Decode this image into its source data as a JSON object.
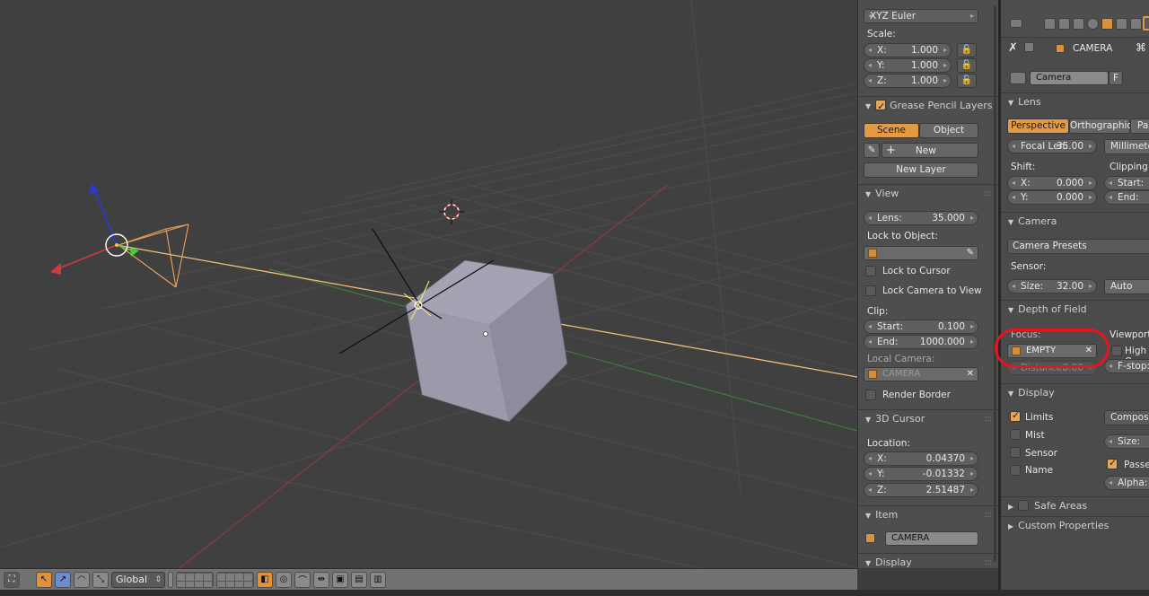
{
  "viewport": {
    "header": {
      "orientation": "Global",
      "colors": {
        "accent": "#e0913a",
        "annotation_red": "#e8141c"
      }
    }
  },
  "npanel": {
    "rotation_mode": "XYZ Euler",
    "scale": {
      "label": "Scale:",
      "x_label": "X:",
      "x": "1.000",
      "y_label": "Y:",
      "y": "1.000",
      "z_label": "Z:",
      "z": "1.000"
    },
    "grease_pencil": {
      "title": "Grease Pencil Layers",
      "scene_tab": "Scene",
      "object_tab": "Object",
      "new_label": "New",
      "new_layer_label": "New Layer"
    },
    "view": {
      "title": "View",
      "lens_label": "Lens:",
      "lens": "35.000",
      "lock_to_object": "Lock to Object:",
      "lock_to_cursor": "Lock to Cursor",
      "lock_camera_to_view": "Lock Camera to View",
      "clip": "Clip:",
      "clip_start_label": "Start:",
      "clip_start": "0.100",
      "clip_end_label": "End:",
      "clip_end": "1000.000",
      "local_camera": "Local Camera:",
      "local_camera_value": "CAMERA",
      "render_border": "Render Border"
    },
    "cursor": {
      "title": "3D Cursor",
      "location": "Location:",
      "x_label": "X:",
      "x": "0.04370",
      "y_label": "Y:",
      "y": "-0.01332",
      "z_label": "Z:",
      "z": "2.51487"
    },
    "item": {
      "title": "Item",
      "name": "CAMERA"
    },
    "display": {
      "title": "Display"
    }
  },
  "props": {
    "context_object": "CAMERA",
    "datablock": "Camera",
    "datablock_flag": "F",
    "lens": {
      "title": "Lens",
      "tabs": [
        "Perspective",
        "Orthographic",
        "Pa"
      ],
      "focal_label": "Focal Len:",
      "focal": "35.00",
      "units": "Millimete",
      "shift": "Shift:",
      "shift_x_label": "X:",
      "shift_x": "0.000",
      "shift_y_label": "Y:",
      "shift_y": "0.000",
      "clipping": "Clipping:",
      "clip_start_label": "Start:",
      "clip_end_label": "End:"
    },
    "camera": {
      "title": "Camera",
      "presets": "Camera Presets",
      "sensor": "Sensor:",
      "size_label": "Size:",
      "size": "32.00",
      "fit": "Auto"
    },
    "dof": {
      "title": "Depth of Field",
      "focus": "Focus:",
      "focus_object": "EMPTY",
      "distance_label": "Distance:",
      "distance": "0.00",
      "viewport": "Viewport:",
      "high_quality": "High Q",
      "fstop_label": "F-stop:"
    },
    "display": {
      "title": "Display",
      "limits": "Limits",
      "mist": "Mist",
      "sensor": "Sensor",
      "name": "Name",
      "composition": "Composit",
      "size_label": "Size:",
      "passepartout": "Passep",
      "alpha_label": "Alpha:"
    },
    "safe_areas": "Safe Areas",
    "custom_properties": "Custom Properties"
  }
}
